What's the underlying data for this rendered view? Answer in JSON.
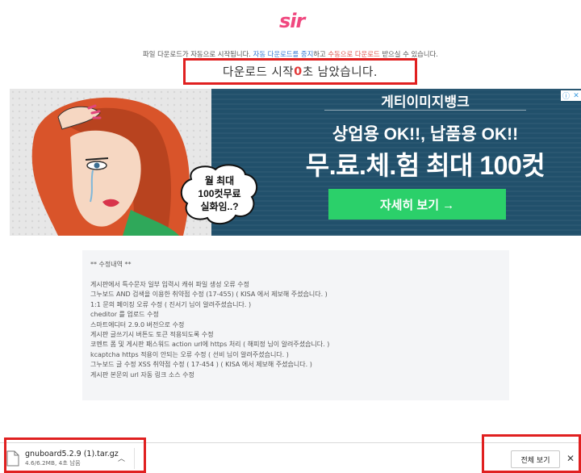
{
  "logo": {
    "text": "sir"
  },
  "notice": {
    "prefix": "파일 다운로드가 자동으로 시작됩니다. ",
    "link_stop": "자동 다운로드를 중지",
    "middle": "하고 ",
    "link_manual": "수동으로 다운로드",
    "suffix": " 받으실 수 있습니다."
  },
  "countdown": {
    "before": "다운로드 시작 ",
    "seconds": "0",
    "after": "초 남았습니다."
  },
  "ad": {
    "brand": "게티이미지뱅크",
    "line1": "상업용 OK!!, 납품용 OK!!",
    "line2": "무.료.체.험 최대 100컷",
    "cta": "자세히 보기 →",
    "bubble": "월 최대\n100컷무료\n실화임..?",
    "info_icon": "ad-info-icon",
    "close_icon": "ad-close-icon"
  },
  "changelog": {
    "title": "** 수정내역 **",
    "items": [
      "게시판에서 특수문자 일부 입력시 캐쉬 파일 생성 오류 수정",
      "그누보드 AND 검색을 이용한 취약점 수정 (17-455) ( KISA 에서 제보해 주셨습니다. )",
      "1:1 문의 페이징 오류 수정 ( 진서기 님이 알려주셨습니다. )",
      "cheditor 를 업로드 수정",
      "스마트에디터 2.9.0 버전으로 수정",
      "게시판 글쓰기시 버튼도 토큰 적용되도록 수정",
      "코멘트 폼 및 게시판 패스워드 action url에 https 처리 ( 해피정 님이 알려주셨습니다. )",
      "kcaptcha https 적용이 안되는 오류 수정 ( 선비 님이 알려주셨습니다. )",
      "그누보드 글 수정 XSS 취약점 수정 ( 17-454 ) ( KISA 에서 제보해 주셨습니다. )",
      "게시판 본문의 url 자동 링크 소스 수정"
    ]
  },
  "download_bar": {
    "file_name": "gnuboard5.2.9 (1).tar.gz",
    "status": "4.6/6.2MB, 4초 남음",
    "show_all": "전체 보기",
    "file_icon": "file-icon",
    "chevron_icon": "chevron-up-icon",
    "close_icon": "close-icon"
  },
  "colors": {
    "accent_pink": "#f0487f",
    "link_blue": "#3a7bd5",
    "highlight_red": "#e02020",
    "ad_bg": "#21506b",
    "cta_green": "#2bd06a"
  }
}
